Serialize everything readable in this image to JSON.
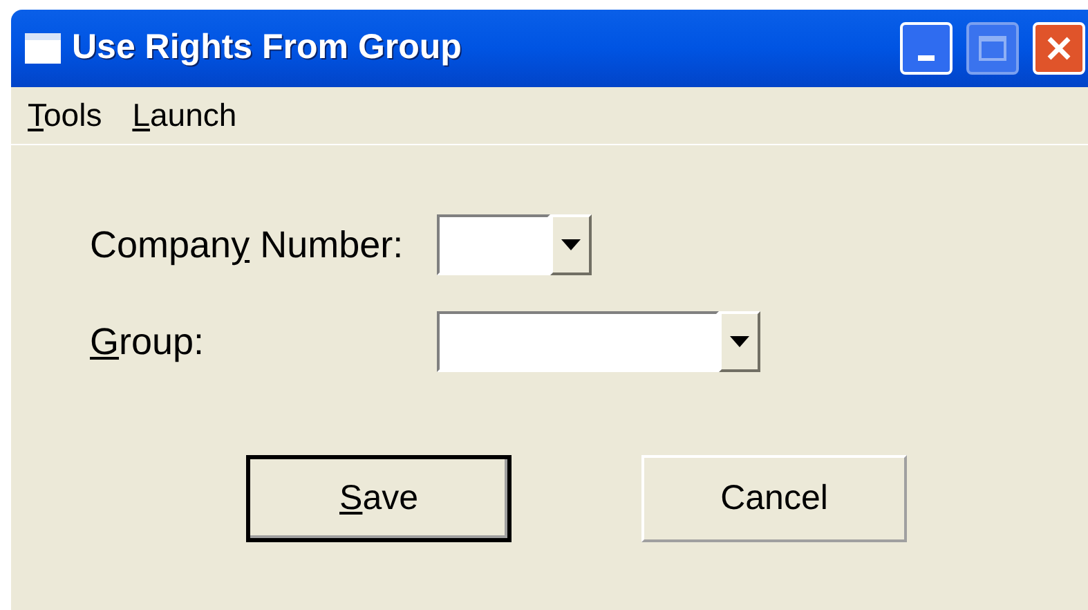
{
  "window": {
    "title": "Use Rights From Group"
  },
  "menu": [
    {
      "label": [
        {
          "text": "T",
          "underline": true
        },
        {
          "text": "ools",
          "underline": false
        }
      ]
    },
    {
      "label": [
        {
          "text": "L",
          "underline": true
        },
        {
          "text": "aunch",
          "underline": false
        }
      ]
    }
  ],
  "fields": [
    {
      "label": [
        {
          "text": "Compan",
          "underline": false
        },
        {
          "text": "y",
          "underline": true
        },
        {
          "text": " Number:",
          "underline": false
        }
      ]
    },
    {
      "label": [
        {
          "text": "G",
          "underline": true
        },
        {
          "text": "roup:",
          "underline": false
        }
      ]
    }
  ],
  "buttons": [
    {
      "label": [
        {
          "text": "S",
          "underline": true
        },
        {
          "text": "ave",
          "underline": false
        }
      ],
      "default": true
    },
    {
      "label": [
        {
          "text": "Cancel",
          "underline": false
        }
      ],
      "default": false
    }
  ]
}
